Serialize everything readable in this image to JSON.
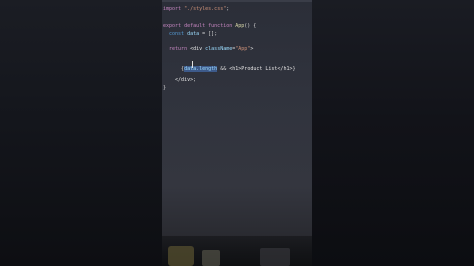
{
  "editor": {
    "lines": [
      {
        "id": "line-import",
        "tokens": [
          {
            "text": "import ",
            "role": "keyword"
          },
          {
            "text": "\"./styles.css\"",
            "role": "string"
          },
          {
            "text": ";",
            "role": "punct"
          }
        ]
      },
      {
        "id": "line-export",
        "tokens": [
          {
            "text": "export default function ",
            "role": "keyword"
          },
          {
            "text": "App",
            "role": "function"
          },
          {
            "text": "() {",
            "role": "punct"
          }
        ]
      },
      {
        "id": "line-const",
        "tokens": [
          {
            "text": "  const ",
            "role": "keyword2"
          },
          {
            "text": "data",
            "role": "variable"
          },
          {
            "text": " = [];",
            "role": "punct"
          }
        ]
      },
      {
        "id": "line-return",
        "tokens": [
          {
            "text": "  return ",
            "role": "keyword"
          },
          {
            "text": "<div ",
            "role": "tag"
          },
          {
            "text": "className",
            "role": "attr"
          },
          {
            "text": "=",
            "role": "punct"
          },
          {
            "text": "\"App\"",
            "role": "string"
          },
          {
            "text": ">",
            "role": "tag"
          }
        ]
      },
      {
        "id": "line-expr",
        "tokens": [
          {
            "text": "      {",
            "role": "punct"
          },
          {
            "text": "data.length",
            "role": "selected"
          },
          {
            "text": " && ",
            "role": "punct"
          },
          {
            "text": "<h1>",
            "role": "tag"
          },
          {
            "text": "Product List",
            "role": "text"
          },
          {
            "text": "</h1>",
            "role": "tag"
          },
          {
            "text": "}",
            "role": "punct"
          }
        ]
      },
      {
        "id": "line-close-div",
        "tokens": [
          {
            "text": "    </div>",
            "role": "tag"
          },
          {
            "text": ";",
            "role": "punct"
          }
        ]
      },
      {
        "id": "line-close-fn",
        "tokens": [
          {
            "text": "}",
            "role": "punct"
          }
        ]
      }
    ]
  },
  "colors": {
    "keyword": "#c586c0",
    "keyword2": "#569cd6",
    "function": "#dcdcaa",
    "string": "#ce9178",
    "variable": "#9cdcfe",
    "selection": "#3d5a8a",
    "editor_background": "#30333d"
  }
}
